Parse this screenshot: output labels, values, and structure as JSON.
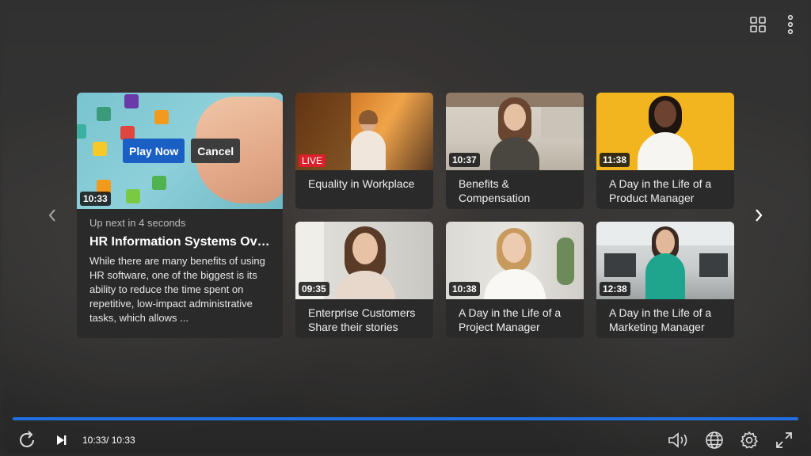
{
  "featured": {
    "duration": "10:33",
    "play_label": "Play Now",
    "cancel_label": "Cancel",
    "upnext": "Up next in 4 seconds",
    "title": "HR Information Systems Over...",
    "description": "While there are many benefits of using HR software, one of the biggest is its ability to reduce the time spent on repetitive, low-impact administrative tasks, which allows ..."
  },
  "videos": [
    {
      "title": "Equality in Workplace",
      "badge": "LIVE",
      "icon": "speaker-thumbnail"
    },
    {
      "title": "Benefits & Compensation",
      "duration": "10:37",
      "icon": "presenter-thumbnail"
    },
    {
      "title": "A Day in the Life of a Product Manager",
      "duration": "11:38",
      "icon": "woman-yellow-thumbnail"
    },
    {
      "title": "Enterprise Customers Share their stories",
      "duration": "09:35",
      "icon": "woman-smiling-thumbnail"
    },
    {
      "title": "A Day in the Life of a Project Manager",
      "duration": "10:38",
      "icon": "woman-blonde-thumbnail"
    },
    {
      "title": "A Day in the Life of a Marketing Manager",
      "duration": "12:38",
      "icon": "woman-office-thumbnail"
    }
  ],
  "player": {
    "time": "10:33/ 10:33",
    "progress": 1.0
  },
  "colors": {
    "accent": "#1f6fe0",
    "play_button": "#1a5fc4",
    "live": "#d9202b"
  }
}
